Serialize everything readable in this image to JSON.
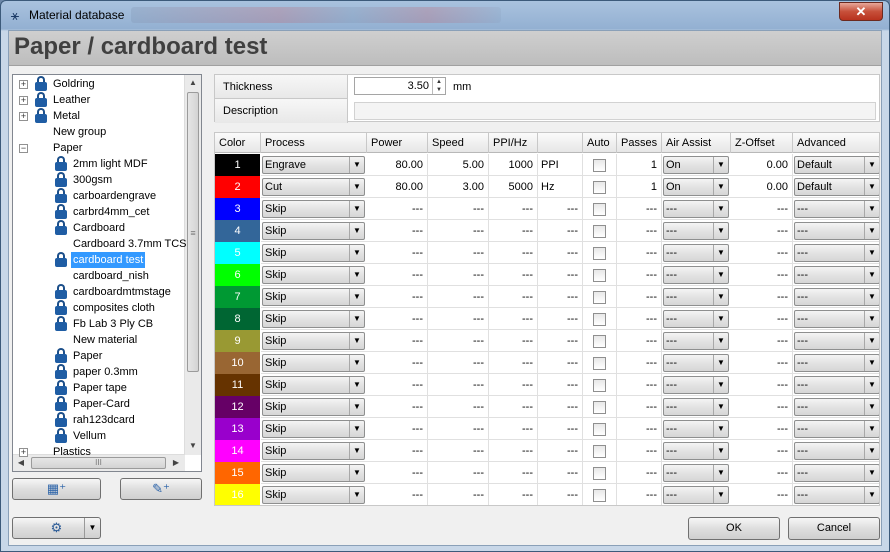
{
  "window": {
    "title": "Material database",
    "app_icon": "tree-network-icon",
    "close_label": "✕"
  },
  "page": {
    "title": "Paper / cardboard test"
  },
  "tree": {
    "items": [
      {
        "label": "Goldring",
        "level": 0,
        "expander": "+",
        "locked": true
      },
      {
        "label": "Leather",
        "level": 0,
        "expander": "+",
        "locked": true
      },
      {
        "label": "Metal",
        "level": 0,
        "expander": "+",
        "locked": true
      },
      {
        "label": "New group",
        "level": 0,
        "expander": "",
        "locked": false
      },
      {
        "label": "Paper",
        "level": 0,
        "expander": "−",
        "locked": false
      },
      {
        "label": "2mm light MDF",
        "level": 1,
        "locked": true
      },
      {
        "label": "300gsm",
        "level": 1,
        "locked": true
      },
      {
        "label": "carboardengrave",
        "level": 1,
        "locked": true
      },
      {
        "label": "carbrd4mm_cet",
        "level": 1,
        "locked": true
      },
      {
        "label": "Cardboard",
        "level": 1,
        "locked": true
      },
      {
        "label": "Cardboard 3.7mm TCS",
        "level": 1,
        "locked": false
      },
      {
        "label": "cardboard test",
        "level": 1,
        "locked": true,
        "selected": true
      },
      {
        "label": "cardboard_nish",
        "level": 1,
        "locked": false
      },
      {
        "label": "cardboardmtmstage",
        "level": 1,
        "locked": true
      },
      {
        "label": "composites cloth",
        "level": 1,
        "locked": true
      },
      {
        "label": "Fb Lab 3 Ply CB",
        "level": 1,
        "locked": true
      },
      {
        "label": "New material",
        "level": 1,
        "locked": false
      },
      {
        "label": "Paper",
        "level": 1,
        "locked": true
      },
      {
        "label": "paper 0.3mm",
        "level": 1,
        "locked": true
      },
      {
        "label": "Paper tape",
        "level": 1,
        "locked": true
      },
      {
        "label": "Paper-Card",
        "level": 1,
        "locked": true
      },
      {
        "label": "rah123dcard",
        "level": 1,
        "locked": true
      },
      {
        "label": "Vellum",
        "level": 1,
        "locked": true
      },
      {
        "label": "Plastics",
        "level": 0,
        "expander": "+",
        "locked": false
      }
    ],
    "scroll_grip": "≡",
    "hscroll_grip": "III"
  },
  "left_buttons": {
    "add_group_icon": "add-group-icon",
    "add_material_icon": "add-material-icon",
    "settings_icon": "gear-icon"
  },
  "properties": {
    "thickness_label": "Thickness",
    "thickness_value": "3.50",
    "thickness_unit": "mm",
    "description_label": "Description",
    "description_value": ""
  },
  "grid": {
    "headers": [
      "Color",
      "Process",
      "Power",
      "Speed",
      "PPI/Hz",
      "",
      "Auto",
      "Passes",
      "Air Assist",
      "Z-Offset",
      "Advanced"
    ],
    "rows": [
      {
        "n": "1",
        "color": "#000000",
        "process": "Engrave",
        "power": "80.00",
        "speed": "5.00",
        "ppi": "1000",
        "unit": "PPI",
        "passes": "1",
        "air": "On",
        "z": "0.00",
        "adv": "Default"
      },
      {
        "n": "2",
        "color": "#ff0000",
        "process": "Cut",
        "power": "80.00",
        "speed": "3.00",
        "ppi": "5000",
        "unit": "Hz",
        "passes": "1",
        "air": "On",
        "z": "0.00",
        "adv": "Default"
      },
      {
        "n": "3",
        "color": "#0000ff",
        "process": "Skip",
        "power": "---",
        "speed": "---",
        "ppi": "---",
        "unit": "---",
        "passes": "---",
        "air": "---",
        "z": "---",
        "adv": "---"
      },
      {
        "n": "4",
        "color": "#336699",
        "process": "Skip",
        "power": "---",
        "speed": "---",
        "ppi": "---",
        "unit": "---",
        "passes": "---",
        "air": "---",
        "z": "---",
        "adv": "---"
      },
      {
        "n": "5",
        "color": "#00ffff",
        "process": "Skip",
        "power": "---",
        "speed": "---",
        "ppi": "---",
        "unit": "---",
        "passes": "---",
        "air": "---",
        "z": "---",
        "adv": "---"
      },
      {
        "n": "6",
        "color": "#00ff00",
        "process": "Skip",
        "power": "---",
        "speed": "---",
        "ppi": "---",
        "unit": "---",
        "passes": "---",
        "air": "---",
        "z": "---",
        "adv": "---"
      },
      {
        "n": "7",
        "color": "#009933",
        "process": "Skip",
        "power": "---",
        "speed": "---",
        "ppi": "---",
        "unit": "---",
        "passes": "---",
        "air": "---",
        "z": "---",
        "adv": "---"
      },
      {
        "n": "8",
        "color": "#006633",
        "process": "Skip",
        "power": "---",
        "speed": "---",
        "ppi": "---",
        "unit": "---",
        "passes": "---",
        "air": "---",
        "z": "---",
        "adv": "---"
      },
      {
        "n": "9",
        "color": "#999933",
        "process": "Skip",
        "power": "---",
        "speed": "---",
        "ppi": "---",
        "unit": "---",
        "passes": "---",
        "air": "---",
        "z": "---",
        "adv": "---"
      },
      {
        "n": "10",
        "color": "#996633",
        "process": "Skip",
        "power": "---",
        "speed": "---",
        "ppi": "---",
        "unit": "---",
        "passes": "---",
        "air": "---",
        "z": "---",
        "adv": "---"
      },
      {
        "n": "11",
        "color": "#663300",
        "process": "Skip",
        "power": "---",
        "speed": "---",
        "ppi": "---",
        "unit": "---",
        "passes": "---",
        "air": "---",
        "z": "---",
        "adv": "---"
      },
      {
        "n": "12",
        "color": "#660066",
        "process": "Skip",
        "power": "---",
        "speed": "---",
        "ppi": "---",
        "unit": "---",
        "passes": "---",
        "air": "---",
        "z": "---",
        "adv": "---"
      },
      {
        "n": "13",
        "color": "#9900cc",
        "process": "Skip",
        "power": "---",
        "speed": "---",
        "ppi": "---",
        "unit": "---",
        "passes": "---",
        "air": "---",
        "z": "---",
        "adv": "---"
      },
      {
        "n": "14",
        "color": "#ff00ff",
        "process": "Skip",
        "power": "---",
        "speed": "---",
        "ppi": "---",
        "unit": "---",
        "passes": "---",
        "air": "---",
        "z": "---",
        "adv": "---"
      },
      {
        "n": "15",
        "color": "#ff6600",
        "process": "Skip",
        "power": "---",
        "speed": "---",
        "ppi": "---",
        "unit": "---",
        "passes": "---",
        "air": "---",
        "z": "---",
        "adv": "---"
      },
      {
        "n": "16",
        "color": "#ffff00",
        "process": "Skip",
        "power": "---",
        "speed": "---",
        "ppi": "---",
        "unit": "---",
        "passes": "---",
        "air": "---",
        "z": "---",
        "adv": "---"
      }
    ]
  },
  "buttons": {
    "ok": "OK",
    "cancel": "Cancel"
  }
}
